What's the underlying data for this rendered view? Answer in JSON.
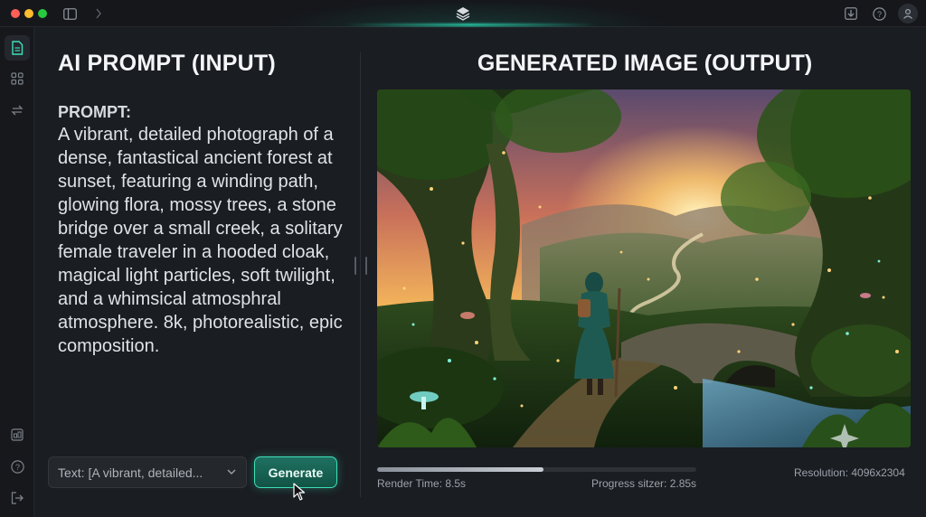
{
  "window": {
    "title": ""
  },
  "titlebar": {
    "icons": [
      "sidebar-toggle-icon",
      "chevron-right-icon",
      "layers-logo-icon",
      "download-icon",
      "help-icon",
      "account-icon"
    ]
  },
  "sidebar": {
    "items": [
      "document-icon",
      "grid-icon",
      "swap-icon",
      "media-icon",
      "help-icon",
      "logout-icon"
    ],
    "active": "document-icon"
  },
  "input_panel": {
    "title": "AI PROMPT (INPUT)",
    "prompt_label": "PROMPT:",
    "prompt_text": "A vibrant, detailed photograph of a dense, fantastical ancient forest at sunset, featuring a winding path, glowing flora, mossy trees, a stone bridge over a small creek, a solitary female traveler in a hooded cloak, magical light particles, soft twilight, and a whimsical atmosphral atmosphere. 8k, photorealistic, epic composition.",
    "text_select_value": "Text: [A vibrant, detailed...",
    "generate_label": "Generate"
  },
  "output_panel": {
    "title": "GENERATED IMAGE (OUTPUT)",
    "render_time": "Render Time: 8.5s",
    "progress_text": "Progress sitzer: 2.85s",
    "resolution": "Resolution: 4096x2304",
    "progress_fraction": 0.52
  },
  "colors": {
    "accent": "#3fe0b8",
    "background": "#1a1d22"
  }
}
